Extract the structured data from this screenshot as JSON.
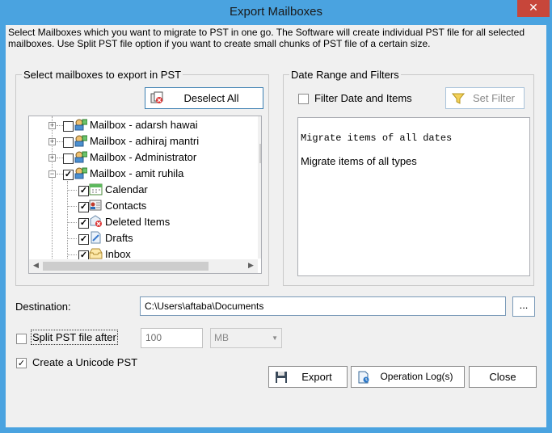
{
  "window": {
    "title": "Export Mailboxes",
    "close_glyph": "✕",
    "instructions": "Select Mailboxes which you want to migrate to PST in one go. The Software will create individual PST file for all selected mailboxes. Use Split PST file option if you want to create small chunks of PST file of a certain size."
  },
  "mailboxes_panel": {
    "legend": "Select mailboxes to export in PST",
    "deselect_label": "Deselect All",
    "tree": [
      {
        "label": "Mailbox - adarsh hawai",
        "checked": false,
        "expander": "+"
      },
      {
        "label": "Mailbox - adhiraj mantri",
        "checked": false,
        "expander": "+"
      },
      {
        "label": "Mailbox - Administrator",
        "checked": false,
        "expander": "+"
      },
      {
        "label": "Mailbox - amit ruhila",
        "checked": true,
        "expander": "−"
      },
      {
        "label": "Calendar",
        "checked": true,
        "icon": "calendar-icon"
      },
      {
        "label": "Contacts",
        "checked": true,
        "icon": "contacts-icon"
      },
      {
        "label": "Deleted Items",
        "checked": true,
        "icon": "deleted-items-icon"
      },
      {
        "label": "Drafts",
        "checked": true,
        "icon": "drafts-icon"
      },
      {
        "label": "Inbox",
        "checked": true,
        "icon": "inbox-icon"
      }
    ]
  },
  "filters_panel": {
    "legend": "Date Range and Filters",
    "filter_checkbox_label": "Filter Date and Items",
    "set_filter_label": "Set Filter",
    "info_line1": "Migrate items of all dates",
    "info_line2": "Migrate items of all types"
  },
  "destination": {
    "label": "Destination:",
    "path": "C:\\Users\\aftaba\\Documents",
    "browse_label": "..."
  },
  "split": {
    "label": "Split PST file after",
    "size_value": "100",
    "unit": "MB"
  },
  "unicode": {
    "label": "Create a Unicode PST",
    "checked": true
  },
  "actions": {
    "export_label": "Export",
    "log_label": "Operation Log(s)",
    "close_label": "Close"
  },
  "colors": {
    "titlebar": "#4aa3e0",
    "close_button": "#c7463a",
    "dialog_bg": "#f0f0f0"
  }
}
